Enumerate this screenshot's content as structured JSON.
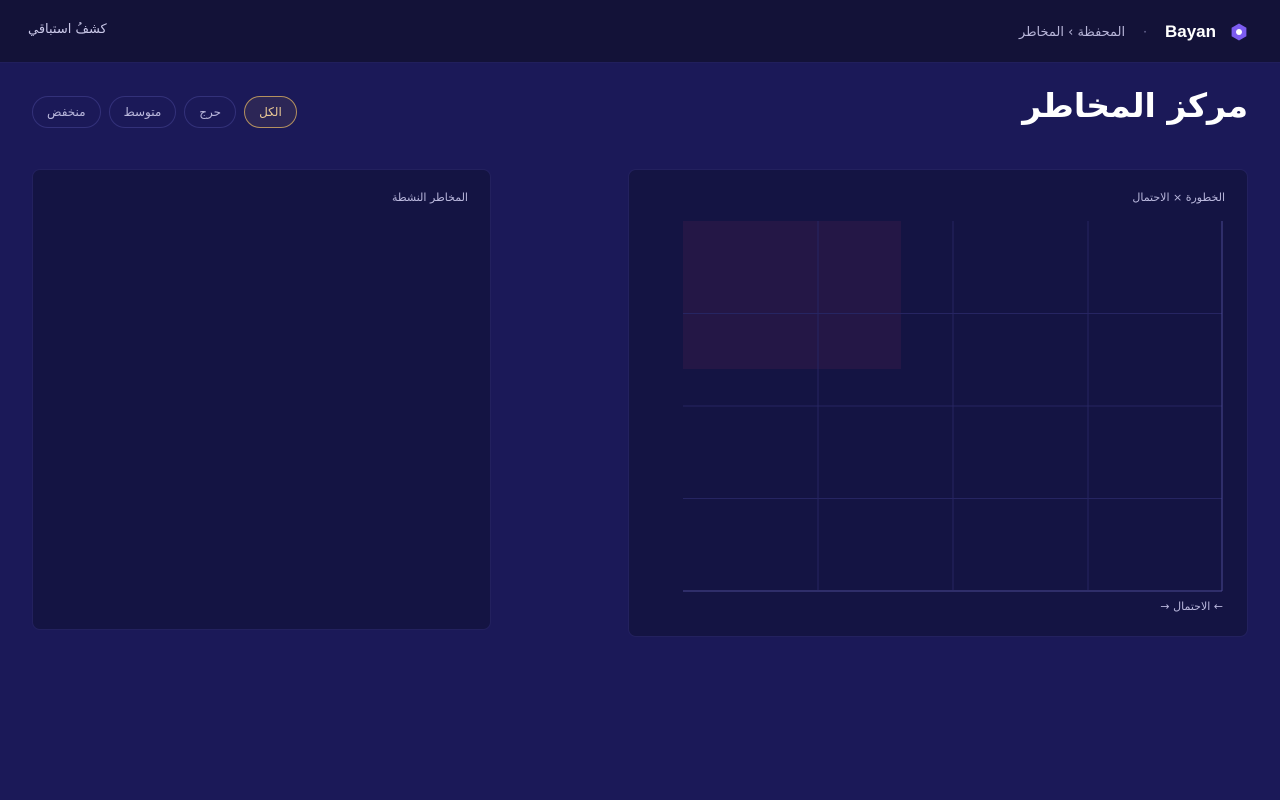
{
  "header": {
    "brand_name": "Bayan",
    "separator": "·",
    "breadcrumb": "المحفظة › المخاطر",
    "exit_preview": "كشفُ استباقي"
  },
  "page": {
    "title": "مركز المخاطر"
  },
  "filters": [
    {
      "label": "الكل",
      "active": true
    },
    {
      "label": "حرج",
      "active": false
    },
    {
      "label": "متوسط",
      "active": false
    },
    {
      "label": "منخفض",
      "active": false
    }
  ],
  "active_risks": {
    "title": "المخاطر النشطة"
  },
  "matrix": {
    "title": "الخطورة × الاحتمال",
    "x_axis_caption": "← الاحتمال →",
    "columns": 4,
    "rows": 4,
    "highlight_color": "#2a1847"
  },
  "colors": {
    "background": "#1b1958",
    "topbar": "#131238",
    "panel": "#141443",
    "accent": "#7c5cf0",
    "active_chip": "#b4915f"
  },
  "icons": {
    "brand_logo": "hexagon-logo-icon"
  }
}
